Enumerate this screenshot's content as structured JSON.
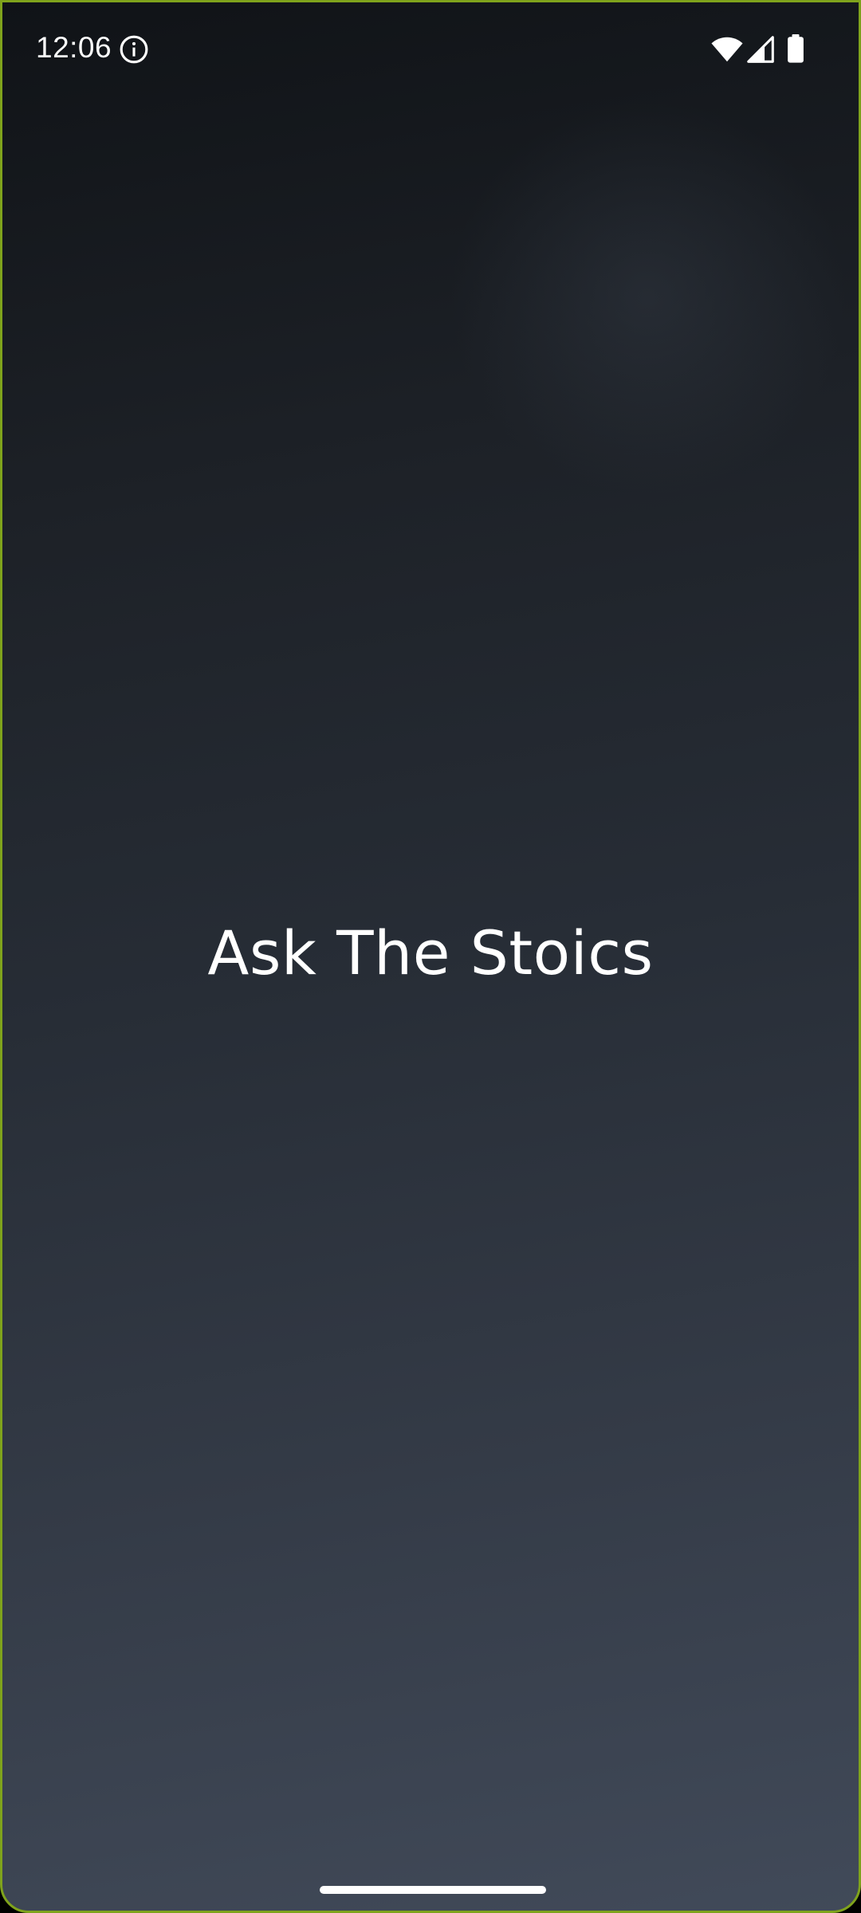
{
  "status_bar": {
    "time": "12:06",
    "icons": [
      "info-icon",
      "wifi-icon",
      "signal-icon",
      "battery-icon"
    ]
  },
  "splash": {
    "title": "Ask The Stoics"
  },
  "colors": {
    "gradient_top": "#101317",
    "gradient_bottom": "#414a59",
    "text": "#ffffff",
    "frame_border": "#7fa31c"
  }
}
